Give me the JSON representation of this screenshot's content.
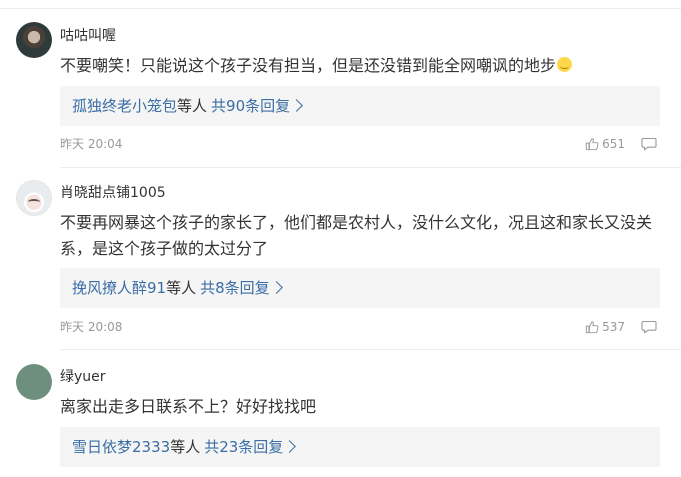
{
  "comments": [
    {
      "username": "咕咕叫喔",
      "content": "不要嘲笑！只能说这个孩子没有担当，但是还没错到能全网嘲讽的地步",
      "emoji": "smile-emoji",
      "reply_names": "孤独终老小笼包",
      "reply_mid": "等人",
      "reply_count": "共90条回复",
      "time": "昨天 20:04",
      "likes": "651"
    },
    {
      "username": "肖晓甜点铺1005",
      "content": "不要再网暴这个孩子的家长了，他们都是农村人，没什么文化，况且这和家长又没关系，是这个孩子做的太过分了",
      "reply_names": "挽风撩人醉91",
      "reply_mid": "等人",
      "reply_count": "共8条回复",
      "time": "昨天 20:08",
      "likes": "537"
    },
    {
      "username": "绿yuer",
      "content": "离家出走多日联系不上？好好找找吧",
      "reply_names": "雪日依梦2333",
      "reply_mid": "等人",
      "reply_count": "共23条回复"
    }
  ],
  "icons": {
    "like": "thumbs-up-icon",
    "reply": "comment-bubble-icon"
  },
  "colors": {
    "link": "#3a6ea5",
    "meta": "#999999",
    "reply_bg": "#f5f5f5"
  }
}
